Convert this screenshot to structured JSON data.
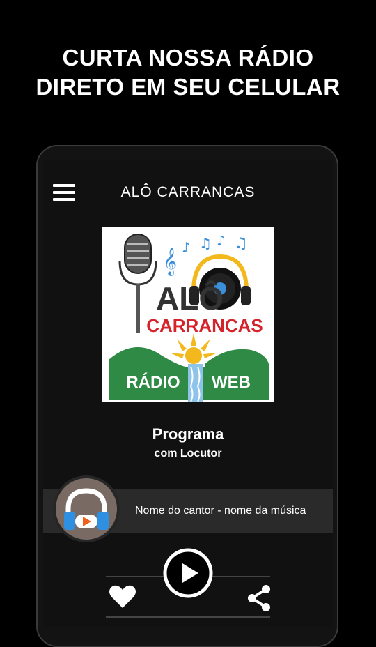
{
  "promo": {
    "line1": "CURTA NOSSA RÁDIO",
    "line2": "DIRETO EM SEU CELULAR"
  },
  "app": {
    "title": "ALÔ CARRANCAS"
  },
  "logo": {
    "text_alo": "ALÔ",
    "text_carrancas": "CARRANCAS",
    "text_radio": "RÁDIO",
    "text_web": "WEB"
  },
  "program": {
    "title": "Programa",
    "host": "com Locutor"
  },
  "now_playing": {
    "track": "Nome do cantor - nome da música"
  },
  "icons": {
    "menu": "hamburger-menu-icon",
    "headphones": "headphones-icon",
    "play": "play-icon",
    "favorite": "heart-icon",
    "share": "share-icon"
  },
  "colors": {
    "background": "#000000",
    "screen": "#111111",
    "track_bar": "#2a2a2a",
    "cover_bg": "#7a6a64",
    "headphone_blue": "#2f8fe0",
    "play_orange": "#f0601a",
    "logo_red": "#d4232a",
    "logo_green": "#2e8a45",
    "logo_yellow": "#f2b81c"
  }
}
